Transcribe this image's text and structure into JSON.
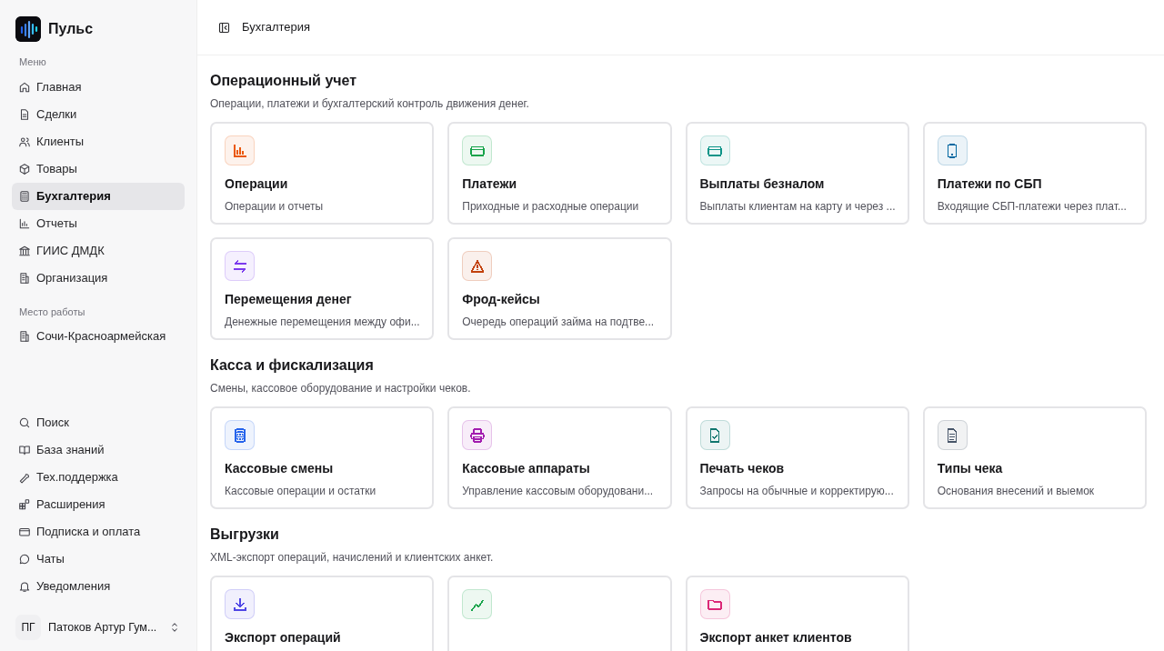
{
  "brand": {
    "name": "Пульс"
  },
  "sidebar": {
    "menu_label": "Меню",
    "items": [
      {
        "kind": "home",
        "label": "Главная",
        "selected": false
      },
      {
        "kind": "file",
        "label": "Сделки",
        "selected": false
      },
      {
        "kind": "users",
        "label": "Клиенты",
        "selected": false
      },
      {
        "kind": "box",
        "label": "Товары",
        "selected": false
      },
      {
        "kind": "calculator",
        "label": "Бухгалтерия",
        "selected": true
      },
      {
        "kind": "chart",
        "label": "Отчеты",
        "selected": false
      },
      {
        "kind": "bank",
        "label": "ГИИС ДМДК",
        "selected": false
      },
      {
        "kind": "building",
        "label": "Организация",
        "selected": false
      }
    ],
    "workplace_label": "Место работы",
    "workplace": {
      "kind": "building",
      "label": "Сочи-Красноармейская"
    },
    "bottom_items": [
      {
        "kind": "search",
        "label": "Поиск"
      },
      {
        "kind": "book",
        "label": "База знаний"
      },
      {
        "kind": "wrench",
        "label": "Тех.поддержка"
      },
      {
        "kind": "blocks",
        "label": "Расширения"
      },
      {
        "kind": "card",
        "label": "Подписка и оплата"
      },
      {
        "kind": "chat",
        "label": "Чаты"
      },
      {
        "kind": "bell",
        "label": "Уведомления"
      }
    ],
    "user": {
      "initials": "ПГ",
      "name": "Патоков Артур Гум..."
    }
  },
  "header": {
    "title": "Бухгалтерия"
  },
  "sections": [
    {
      "title": "Операционный учет",
      "subtitle": "Операции, платежи и бухгалтерский контроль движения денег.",
      "cards": [
        {
          "kind": "chart",
          "color": "#ea580c",
          "title": "Операции",
          "description": "Операции и отчеты"
        },
        {
          "kind": "card",
          "color": "#16a34a",
          "title": "Платежи",
          "description": "Приходные и расходные операции"
        },
        {
          "kind": "card",
          "color": "#0d9488",
          "title": "Выплаты безналом",
          "description": "Выплаты клиентам на карту и через ..."
        },
        {
          "kind": "phone",
          "color": "#0369a1",
          "title": "Платежи по СБП",
          "description": "Входящие СБП-платежи через плат..."
        },
        {
          "kind": "transfer",
          "color": "#7c3aed",
          "title": "Перемещения денег",
          "description": "Денежные перемещения между офи..."
        },
        {
          "kind": "warning",
          "color": "#c2410c",
          "title": "Фрод-кейсы",
          "description": "Очередь операций займа на подтве..."
        }
      ]
    },
    {
      "title": "Касса и фискализация",
      "subtitle": "Смены, кассовое оборудование и настройки чеков.",
      "cards": [
        {
          "kind": "calculator",
          "color": "#2563eb",
          "title": "Кассовые смены",
          "description": "Кассовые операции и остатки"
        },
        {
          "kind": "printer",
          "color": "#a21caf",
          "title": "Кассовые аппараты",
          "description": "Управление кассовым оборудовани..."
        },
        {
          "kind": "receipt",
          "color": "#0f766e",
          "title": "Печать чеков",
          "description": "Запросы на обычные и корректирую..."
        },
        {
          "kind": "document",
          "color": "#475569",
          "title": "Типы чека",
          "description": "Основания внесений и выемок"
        }
      ]
    },
    {
      "title": "Выгрузки",
      "subtitle": "XML-экспорт операций, начислений и клиентских анкет.",
      "cards": [
        {
          "kind": "download",
          "color": "#4f46e5",
          "title": "Экспорт операций"
        },
        {
          "kind": "trend",
          "color": "#16a34a"
        },
        {
          "kind": "folder",
          "color": "#db2777",
          "title": "Экспорт анкет клиентов"
        }
      ]
    }
  ]
}
